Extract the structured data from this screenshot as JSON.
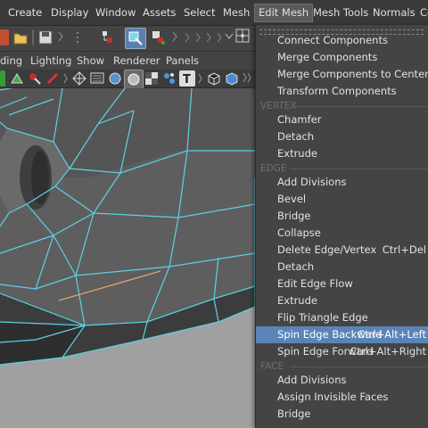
{
  "menubar": {
    "items": [
      "Create",
      "Display",
      "Window",
      "Assets",
      "Select",
      "Mesh",
      "Edit Mesh",
      "Mesh Tools",
      "Normals",
      "Co"
    ],
    "active": "Edit Mesh"
  },
  "panel_menu": {
    "items": [
      "ding",
      "Lighting",
      "Show",
      "Renderer",
      "Panels"
    ]
  },
  "edit_mesh_menu": {
    "general": [
      {
        "label": "Connect Components",
        "shortcut": ""
      },
      {
        "label": "Merge Components",
        "shortcut": ""
      },
      {
        "label": "Merge Components to Center",
        "shortcut": ""
      },
      {
        "label": "Transform Components",
        "shortcut": ""
      }
    ],
    "vertex_header": "VERTEX",
    "vertex": [
      {
        "label": "Chamfer",
        "shortcut": ""
      },
      {
        "label": "Detach",
        "shortcut": ""
      },
      {
        "label": "Extrude",
        "shortcut": ""
      }
    ],
    "edge_header": "EDGE",
    "edge": [
      {
        "label": "Add Divisions",
        "shortcut": ""
      },
      {
        "label": "Bevel",
        "shortcut": ""
      },
      {
        "label": "Bridge",
        "shortcut": ""
      },
      {
        "label": "Collapse",
        "shortcut": ""
      },
      {
        "label": "Delete Edge/Vertex",
        "shortcut": "Ctrl+Del"
      },
      {
        "label": "Detach",
        "shortcut": ""
      },
      {
        "label": "Edit Edge Flow",
        "shortcut": ""
      },
      {
        "label": "Extrude",
        "shortcut": ""
      },
      {
        "label": "Flip Triangle Edge",
        "shortcut": ""
      },
      {
        "label": "Spin Edge Backward",
        "shortcut": "Ctrl+Alt+Left"
      },
      {
        "label": "Spin Edge Forward",
        "shortcut": "Ctrl+Alt+Right"
      }
    ],
    "face_header": "FACE",
    "face": [
      {
        "label": "Add Divisions",
        "shortcut": ""
      },
      {
        "label": "Assign Invisible Faces",
        "shortcut": ""
      },
      {
        "label": "Bridge",
        "shortcut": ""
      }
    ],
    "highlighted": "Spin Edge Backward"
  },
  "colors": {
    "highlight": "#5a84b8",
    "wire": "#5ad2e6",
    "selected_edge": "#e0a070",
    "mesh_face": "#5c5c5c"
  }
}
